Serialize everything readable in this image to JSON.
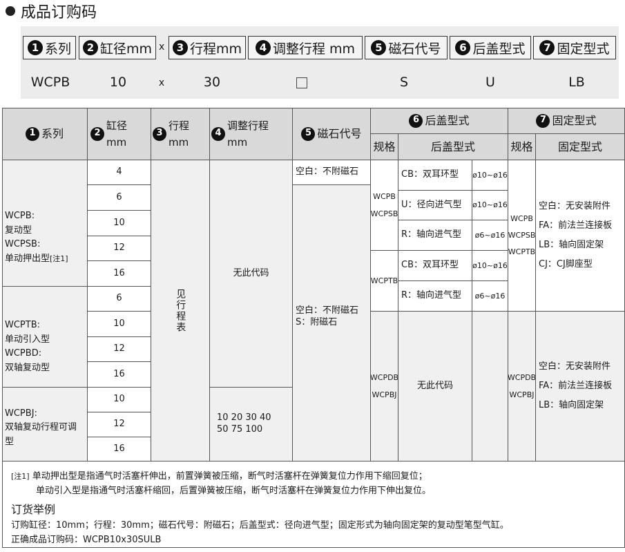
{
  "title": "成品订购码",
  "code_boxes": [
    {
      "num": "1",
      "label": "系列"
    },
    {
      "num": "2",
      "label": "缸径mm"
    },
    {
      "num": "3",
      "label": "行程mm"
    },
    {
      "num": "4",
      "label": "调整行程 mm"
    },
    {
      "num": "5",
      "label": "磁石代号"
    },
    {
      "num": "6",
      "label": "后盖型式"
    },
    {
      "num": "7",
      "label": "固定型式"
    }
  ],
  "times_sign": "x",
  "sample": {
    "series": "WCPB",
    "bore": "10",
    "times": "x",
    "stroke": "30",
    "magnet": "S",
    "cover": "U",
    "mount": "LB"
  },
  "table": {
    "headers": {
      "series": "系列",
      "bore": "缸径 mm",
      "stroke": "行程mm",
      "adjust": "调整行程 mm",
      "magnet": "磁石代号",
      "cover": "后盖型式",
      "mount": "固定型式",
      "spec": "规格",
      "cover_sub": "后盖型式",
      "mount_sub": "固定型式"
    },
    "series_groups": [
      [
        "WCPB:",
        "复动型",
        "WCPSB:",
        "单动押出型"
      ],
      [
        "WCPTB:",
        "单动引入型",
        "WCPBD:",
        "双轴复动型"
      ],
      [
        "WCPBJ:",
        "双轴复动行程可调型"
      ]
    ],
    "note_mark": "[注1]",
    "bores": [
      "4",
      "6",
      "10",
      "12",
      "16",
      "6",
      "10",
      "12",
      "16",
      "10",
      "12",
      "16"
    ],
    "stroke_note": "见行程表",
    "adjust_none": "无此代码",
    "adjust_values": [
      "10 20 30 40",
      "50 75 100"
    ],
    "magnet_top": "空白：不附磁石",
    "magnet_mid": [
      "空白：不附磁石",
      "S：附磁石"
    ],
    "cover_specs": {
      "a": [
        "WCPB",
        "WCPSB"
      ],
      "b": "WCPTB",
      "c": [
        "WCPDB",
        "WCPBJ"
      ]
    },
    "cover_types": [
      {
        "name": "CB：双耳环型",
        "range": "ø10~ø16"
      },
      {
        "name": "U：径向进气型",
        "range": "ø10~ø16"
      },
      {
        "name": "R：轴向进气型",
        "range": "ø6~ø16"
      },
      {
        "name": "CB：双耳环型",
        "range": "ø10~ø16"
      },
      {
        "name": "R：轴向进气型",
        "range": "ø6~ø16"
      }
    ],
    "cover_none": "无此代码",
    "mount_specs_top": [
      "WCPB",
      "WCPSB",
      "WCPTB"
    ],
    "mount_specs_bottom": [
      "WCPDB",
      "WCPBJ"
    ],
    "mount_top": [
      "空白：无安装附件",
      "FA：前法兰连接板",
      "LB：轴向固定架",
      "CJ：CJ脚座型"
    ],
    "mount_bottom": [
      "空白：无安装附件",
      "FA：前法兰连接板",
      "LB：轴向固定架"
    ]
  },
  "footnote": {
    "mark": "[注1]",
    "line1": "单动押出型是指通气时活塞杆伸出，前置弹簧被压缩，断气时活塞杆在弹簧复位力作用下缩回复位；",
    "line2": "单动引入型是指通气时活塞杆缩回，后置弹簧被压缩，断气时活塞杆在弹簧复位力作用下伸出复位。"
  },
  "example": {
    "heading": "订货举例",
    "line1": "订购缸径：10mm；行程：30mm；磁石代号：附磁石；后盖型式：径向进气型；固定形式为轴向固定架的复动型笔型气缸。",
    "line2": "正确成品订购码：WCPB10x30SULB"
  }
}
